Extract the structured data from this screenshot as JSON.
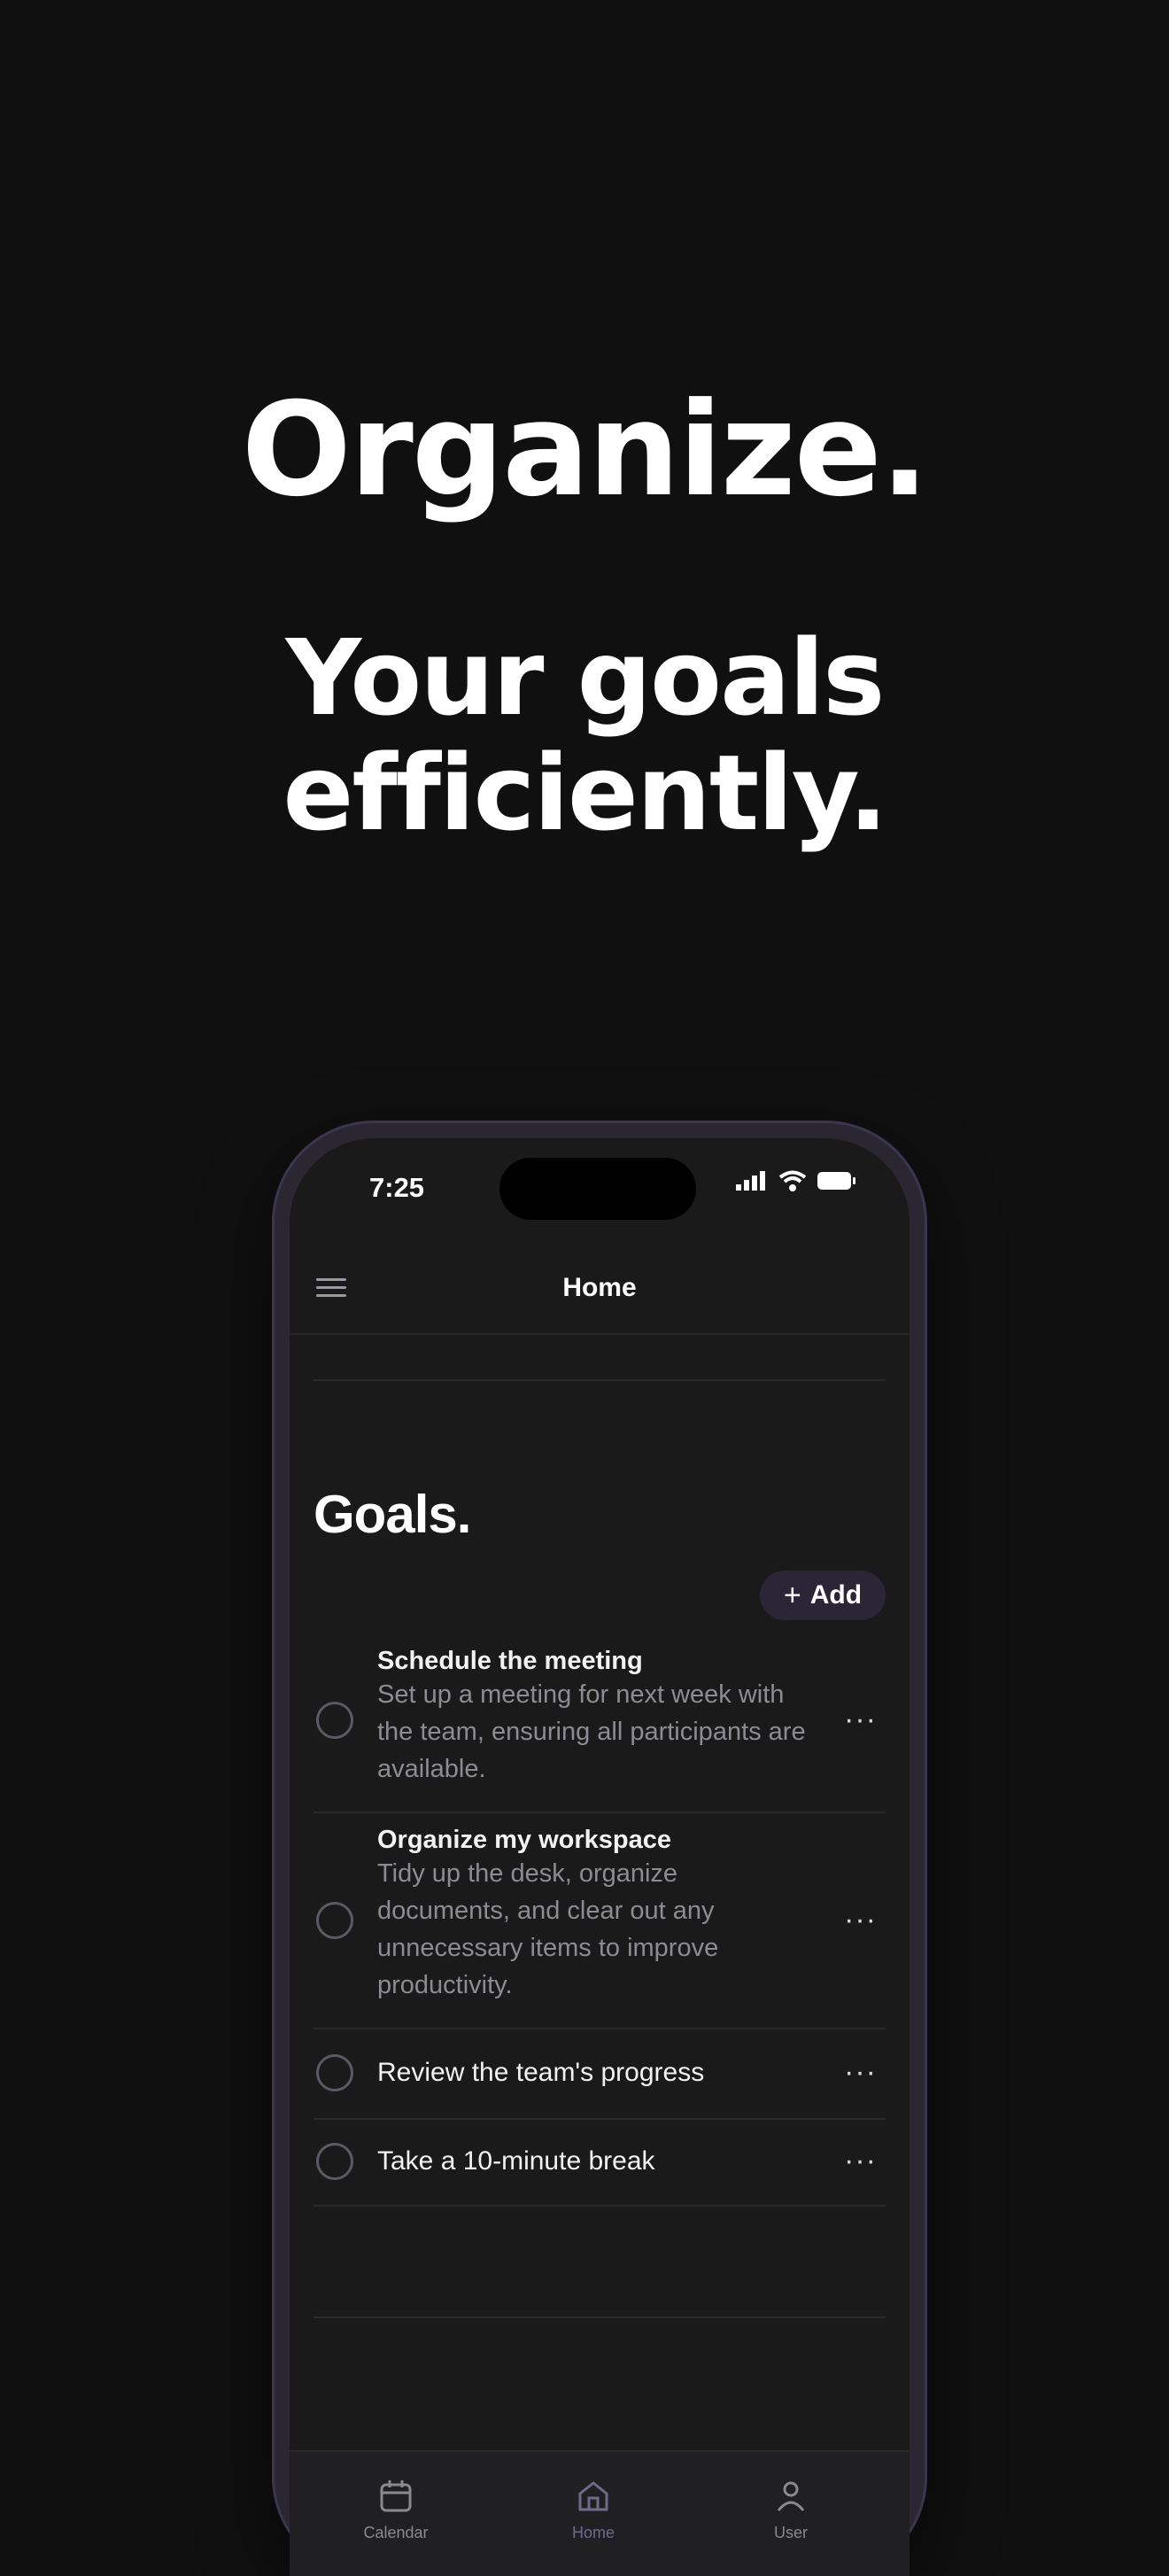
{
  "headline": {
    "line1": "Organize.",
    "line2": "Your goals efficiently."
  },
  "status_bar": {
    "time": "7:25",
    "icons": [
      "cellular-signal-icon",
      "wifi-icon",
      "battery-icon"
    ]
  },
  "nav": {
    "title": "Home",
    "menu_icon": "hamburger-menu-icon"
  },
  "goals": {
    "title": "Goals.",
    "add_label": "Add",
    "items": [
      {
        "title": "Schedule the meeting",
        "description": "Set up a meeting for next week with the team, ensuring all participants are available."
      },
      {
        "title": "Organize my workspace",
        "description": "Tidy up the desk, organize documents, and clear out any unnecessary items to improve productivity."
      },
      {
        "title": "Review the team's progress",
        "description": ""
      },
      {
        "title": "Take a 10-minute break",
        "description": ""
      }
    ],
    "more_label": "···"
  },
  "tabbar": {
    "tabs": [
      {
        "label": "Calendar",
        "icon": "calendar-icon",
        "active": false
      },
      {
        "label": "Home",
        "icon": "home-icon",
        "active": true
      },
      {
        "label": "User",
        "icon": "user-icon",
        "active": false
      }
    ]
  },
  "colors": {
    "background": "#101011",
    "screen": "#1a1a1b",
    "accent": "#2b2538",
    "muted_text": "#8c8c92"
  }
}
